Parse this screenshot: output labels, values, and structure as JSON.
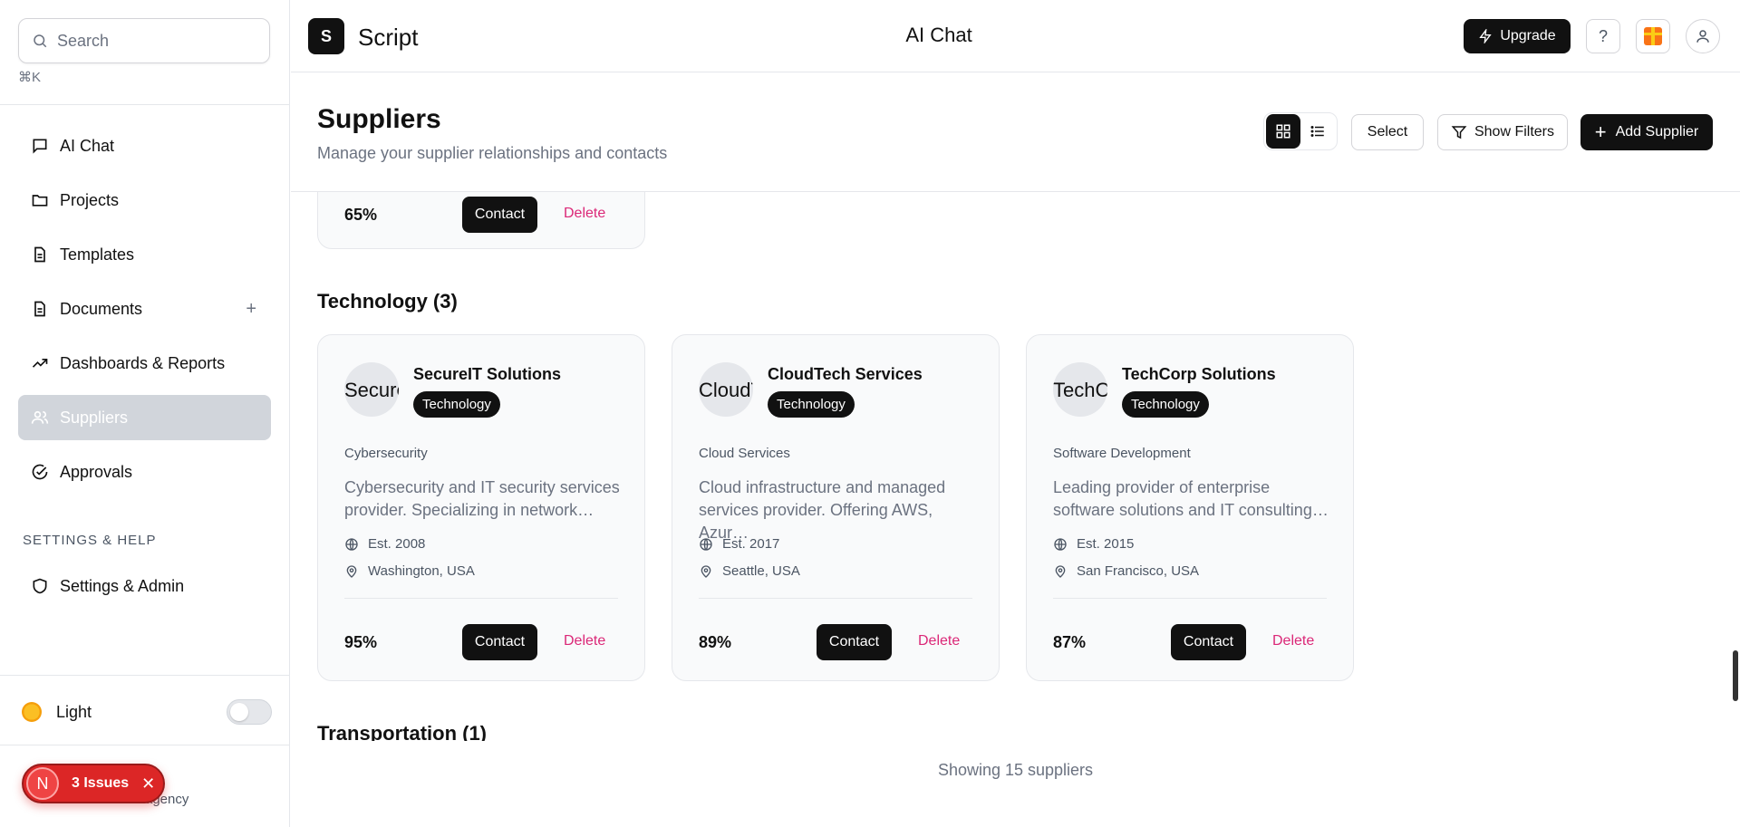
{
  "sidebar": {
    "search_placeholder": "Search",
    "shortcut": "⌘K",
    "items": [
      {
        "label": "AI Chat",
        "icon": "chat-icon"
      },
      {
        "label": "Projects",
        "icon": "folder-icon"
      },
      {
        "label": "Templates",
        "icon": "document-icon"
      },
      {
        "label": "Documents",
        "icon": "document-icon",
        "action": "+"
      },
      {
        "label": "Dashboards & Reports",
        "icon": "trend-icon"
      },
      {
        "label": "Suppliers",
        "icon": "users-icon",
        "active": true
      },
      {
        "label": "Approvals",
        "icon": "check-circle-icon"
      }
    ],
    "section_label": "SETTINGS & HELP",
    "settings_label": "Settings & Admin",
    "theme_label": "Light",
    "user_name": "n",
    "user_org": "agency"
  },
  "issues": {
    "badge": "N",
    "label": "3 Issues"
  },
  "topbar": {
    "logo_letter": "S",
    "brand": "Script",
    "page": "AI Chat",
    "upgrade": "Upgrade",
    "help": "?"
  },
  "header": {
    "title": "Suppliers",
    "subtitle": "Manage your supplier relationships and contacts",
    "select": "Select",
    "filters": "Show Filters",
    "add": "Add Supplier"
  },
  "partial_card": {
    "score": "65%",
    "contact": "Contact",
    "delete": "Delete"
  },
  "category": {
    "heading": "Technology (3)"
  },
  "cards": [
    {
      "avatar_alt": "SecureIT",
      "name": "SecureIT Solutions",
      "badge": "Technology",
      "subcategory": "Cybersecurity",
      "description": "Cybersecurity and IT security services provider. Specializing in network…",
      "established": "Est. 2008",
      "location": "Washington, USA",
      "score": "95%",
      "contact": "Contact",
      "delete": "Delete"
    },
    {
      "avatar_alt": "CloudTech",
      "name": "CloudTech Services",
      "badge": "Technology",
      "subcategory": "Cloud Services",
      "description": "Cloud infrastructure and managed services provider. Offering AWS, Azur…",
      "established": "Est. 2017",
      "location": "Seattle, USA",
      "score": "89%",
      "contact": "Contact",
      "delete": "Delete"
    },
    {
      "avatar_alt": "TechCorp",
      "name": "TechCorp Solutions",
      "badge": "Technology",
      "subcategory": "Software Development",
      "description": "Leading provider of enterprise software solutions and IT consulting…",
      "established": "Est. 2015",
      "location": "San Francisco, USA",
      "score": "87%",
      "contact": "Contact",
      "delete": "Delete"
    }
  ],
  "next_category": "Transportation (1)",
  "footer": "Showing 15 suppliers",
  "colors": {
    "accent": "#111111",
    "delete": "#db2777",
    "issues": "#dc2626",
    "active_nav": "#d1d5db"
  }
}
